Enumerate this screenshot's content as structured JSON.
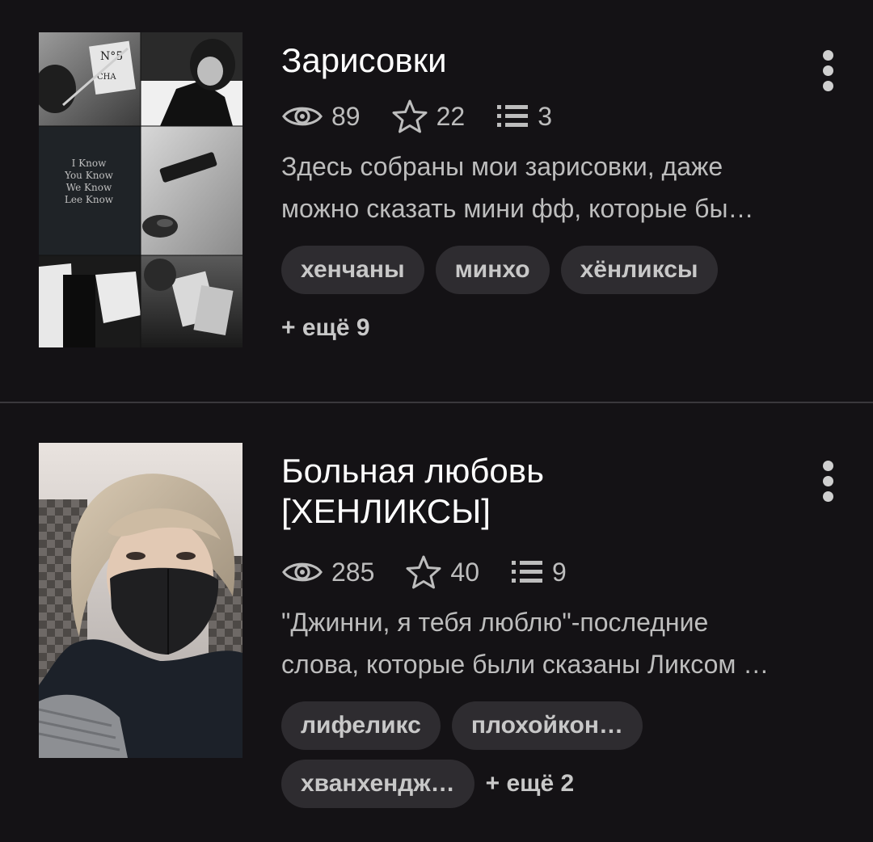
{
  "colors": {
    "background": "#141215",
    "tag_background": "#2e2c30",
    "secondary_text": "#bdbdbd",
    "divider": "#3a383c"
  },
  "cards": [
    {
      "title_lines": [
        "Зарисовки"
      ],
      "stats": {
        "views": "89",
        "likes": "22",
        "parts": "3"
      },
      "description_lines": [
        "Здесь собраны мои зарисовки, даже",
        "можно сказать мини фф, которые бы…"
      ],
      "tags_row1": [
        "хенчаны",
        "минхо",
        "хёнликсы"
      ],
      "more_tags": "+ ещё 9",
      "cover_text": {
        "perfume_label": "N°5",
        "perfume_brand": "CHA",
        "quote_lines": [
          "I Know",
          "You Know",
          "We Know",
          "Lee Know"
        ]
      },
      "icons": {
        "views": "eye-icon",
        "likes": "star-icon",
        "parts": "list-icon",
        "menu": "more-vertical-icon"
      }
    },
    {
      "title_lines": [
        "Больная любовь",
        "[ХЕНЛИКСЫ]"
      ],
      "stats": {
        "views": "285",
        "likes": "40",
        "parts": "9"
      },
      "description_lines": [
        "\"Джинни, я тебя люблю\"-последние",
        "слова, которые были сказаны Ликсом …"
      ],
      "tags_row1": [
        "лифеликс",
        "плохойкон…"
      ],
      "tags_row2": [
        "хванхендж…"
      ],
      "more_tags": "+ ещё 2",
      "icons": {
        "views": "eye-icon",
        "likes": "star-icon",
        "parts": "list-icon",
        "menu": "more-vertical-icon"
      }
    }
  ]
}
